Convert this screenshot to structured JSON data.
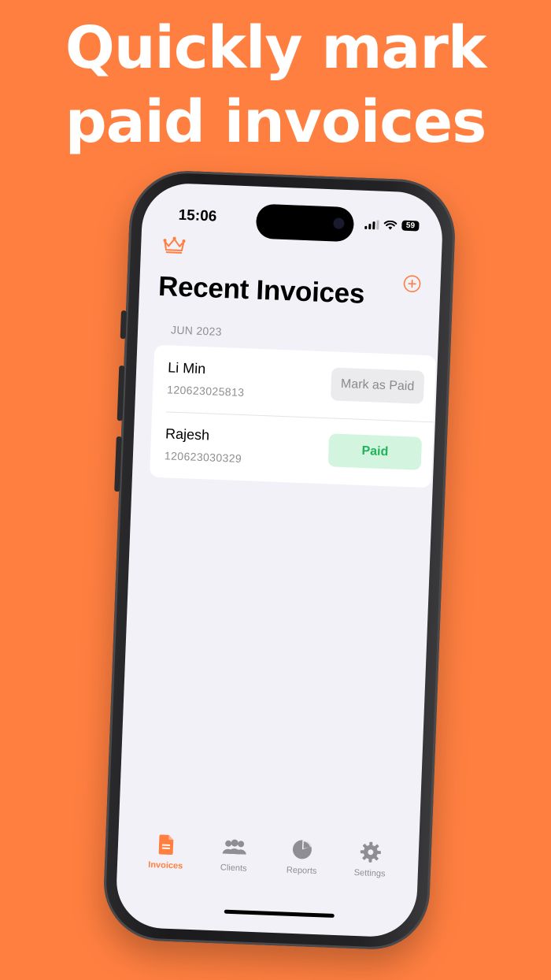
{
  "marketing": {
    "headline_line1": "Quickly mark",
    "headline_line2": "paid invoices"
  },
  "status_bar": {
    "time": "15:06",
    "battery": "59"
  },
  "header": {
    "crown_icon": "crown-icon",
    "add_icon": "plus-circle-icon",
    "title": "Recent Invoices"
  },
  "invoices": {
    "section_label": "JUN 2023",
    "rows": [
      {
        "client": "Li Min",
        "number": "120623025813",
        "action": "Mark as Paid",
        "status": "unpaid"
      },
      {
        "client": "Rajesh",
        "number": "120623030329",
        "action": "Paid",
        "status": "paid"
      }
    ]
  },
  "tabbar": {
    "items": [
      {
        "label": "Invoices",
        "icon": "document-icon",
        "active": true
      },
      {
        "label": "Clients",
        "icon": "people-icon",
        "active": false
      },
      {
        "label": "Reports",
        "icon": "pie-chart-icon",
        "active": false
      },
      {
        "label": "Settings",
        "icon": "gear-icon",
        "active": false
      }
    ]
  },
  "colors": {
    "brand": "#FF7F40",
    "paid_text": "#1FB45A",
    "paid_bg": "#D3F5DF",
    "screen_bg": "#F2F1F7"
  }
}
